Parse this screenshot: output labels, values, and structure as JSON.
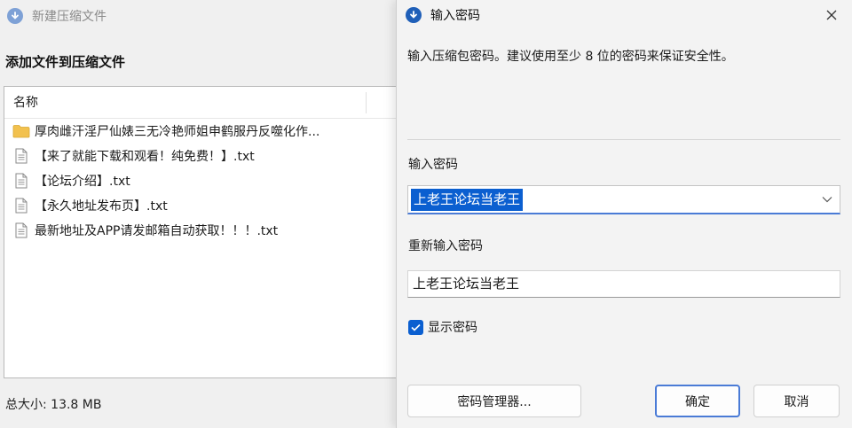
{
  "background_window": {
    "title": "新建压缩文件",
    "heading": "添加文件到压缩文件",
    "column_header": "名称",
    "files": [
      {
        "name": "厚肉雌汗淫尸仙婊三无冷艳师姐申鹤服丹反噬化作...",
        "icon": "folder-icon"
      },
      {
        "name": "【来了就能下载和观看！纯免费！】.txt",
        "icon": "text-file-icon"
      },
      {
        "name": "【论坛介绍】.txt",
        "icon": "text-file-icon"
      },
      {
        "name": "【永久地址发布页】.txt",
        "icon": "text-file-icon"
      },
      {
        "name": "最新地址及APP请发邮箱自动获取！！！.txt",
        "icon": "text-file-icon"
      }
    ],
    "total_size": "总大小: 13.8 MB"
  },
  "dialog": {
    "title": "输入密码",
    "description": "输入压缩包密码。建议使用至少 8 位的密码来保证安全性。",
    "password_label": "输入密码",
    "password_value": "上老王论坛当老王",
    "confirm_label": "重新输入密码",
    "confirm_value": "上老王论坛当老王",
    "show_password": {
      "label": "显示密码",
      "checked": true
    },
    "buttons": {
      "manager": "密码管理器...",
      "ok": "确定",
      "cancel": "取消"
    }
  },
  "colors": {
    "accent": "#0b5fd0",
    "focus_border": "#4a7bd6",
    "folder": "#f2c14e"
  }
}
